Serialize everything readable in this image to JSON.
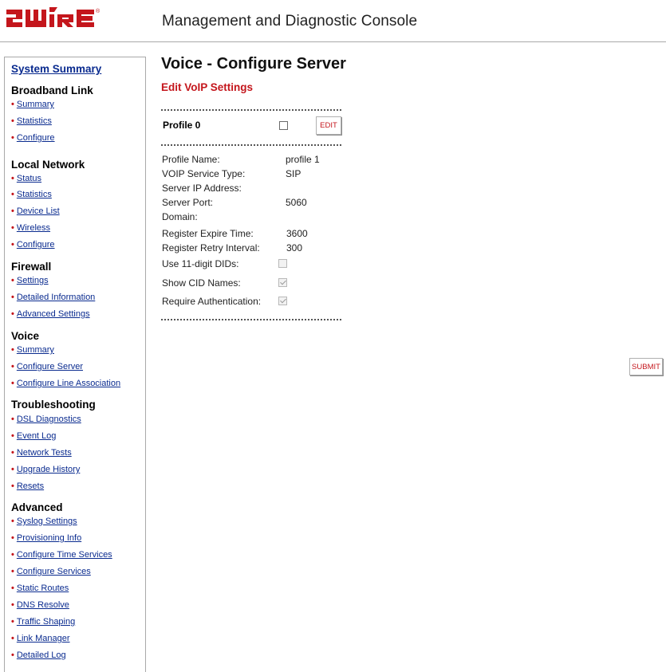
{
  "header": {
    "logo_text": "2WIRE",
    "console_title": "Management and Diagnostic Console"
  },
  "sidebar": {
    "system_summary": "System Summary",
    "sections": [
      {
        "title": "Broadband Link",
        "links": [
          "Summary",
          "Statistics",
          "Configure"
        ]
      },
      {
        "title": "Local Network",
        "links": [
          "Status",
          "Statistics",
          "Device List",
          "Wireless",
          "Configure"
        ]
      },
      {
        "title": "Firewall",
        "links": [
          "Settings",
          "Detailed Information",
          "Advanced Settings"
        ]
      },
      {
        "title": "Voice",
        "links": [
          "Summary",
          "Configure Server",
          "Configure Line Association"
        ]
      },
      {
        "title": "Troubleshooting",
        "links": [
          "DSL Diagnostics",
          "Event Log",
          "Network Tests",
          "Upgrade History",
          "Resets"
        ]
      },
      {
        "title": "Advanced",
        "links": [
          "Syslog Settings",
          "Provisioning Info",
          "Configure Time Services",
          "Configure Services",
          "Static Routes",
          "DNS Resolve",
          "Traffic Shaping",
          "Link Manager",
          "Detailed Log"
        ]
      }
    ]
  },
  "main": {
    "page_title": "Voice - Configure Server",
    "sub_title": "Edit VoIP Settings",
    "profile": {
      "label": "Profile 0",
      "checked": false,
      "edit_label": "EDIT"
    },
    "settings": [
      {
        "label": "Profile Name:",
        "value": "profile 1"
      },
      {
        "label": "VOIP Service Type:",
        "value": "SIP"
      },
      {
        "label": "Server IP Address:",
        "value": ""
      },
      {
        "label": "Server Port:",
        "value": "5060"
      },
      {
        "label": "Domain:",
        "value": ""
      },
      {
        "label": "Register Expire Time:",
        "value": "3600"
      },
      {
        "label": "Register Retry Interval:",
        "value": "300"
      }
    ],
    "checkboxes": [
      {
        "label": "Use 11-digit DIDs:",
        "checked": false
      },
      {
        "label": "Show CID Names:",
        "checked": true
      },
      {
        "label": "Require Authentication:",
        "checked": true
      }
    ],
    "submit_label": "SUBMIT"
  },
  "colors": {
    "accent_red": "#c4161c",
    "link_blue": "#0a2b8f"
  }
}
